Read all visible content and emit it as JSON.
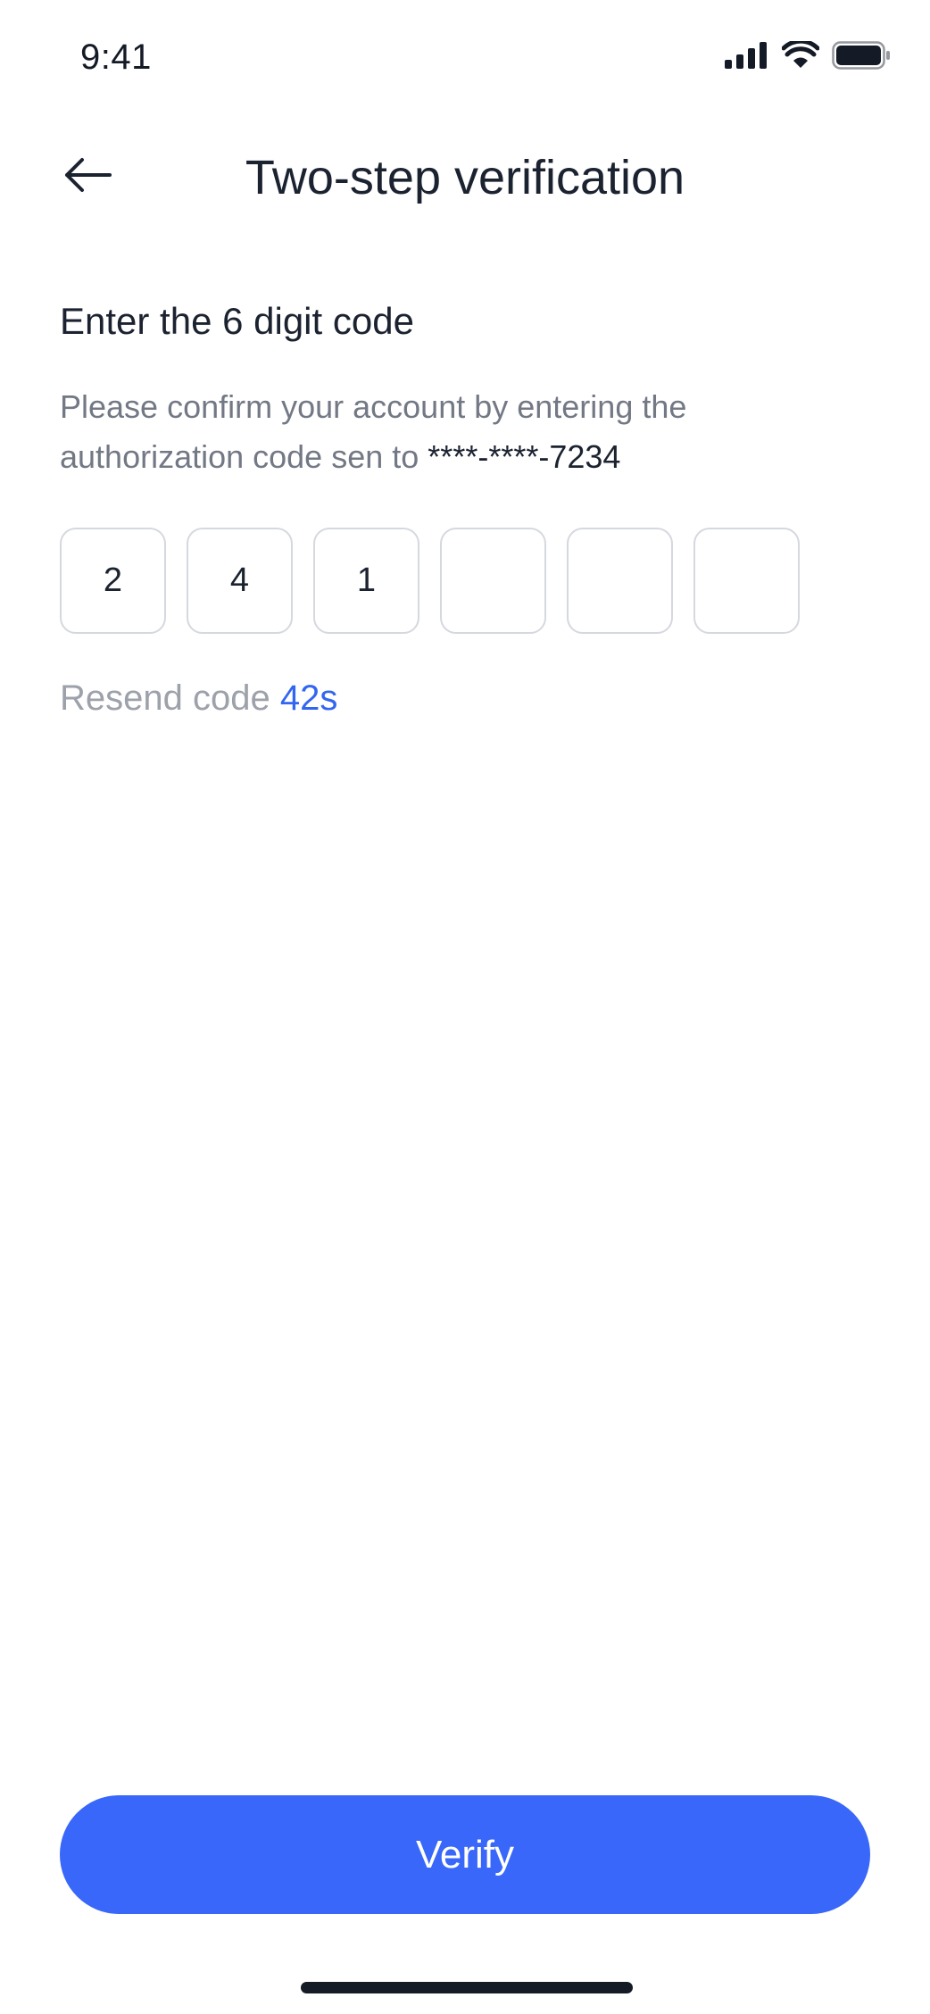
{
  "status_bar": {
    "time": "9:41"
  },
  "header": {
    "back_icon": "arrow-left-icon",
    "title": "Two-step verification"
  },
  "content": {
    "heading": "Enter the 6 digit code",
    "description": "Please confirm your account by entering the authorization code sen to",
    "masked_number": "****-****-7234",
    "code_digits": [
      "2",
      "4",
      "1",
      "",
      "",
      ""
    ],
    "resend_label": "Resend code",
    "resend_timer": "42s"
  },
  "actions": {
    "verify_label": "Verify"
  },
  "colors": {
    "accent": "#3867f9",
    "timer": "#3366f0",
    "text_primary": "#1b2230",
    "text_secondary": "#737885",
    "text_muted": "#9da1aa",
    "box_border": "#d5d8de"
  }
}
